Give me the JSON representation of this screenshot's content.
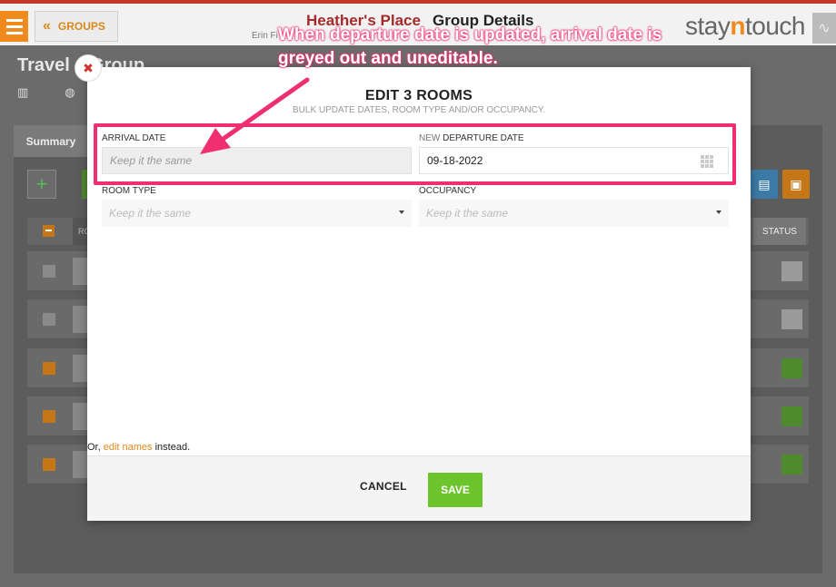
{
  "header": {
    "groups_label": "GROUPS",
    "hotel_name": "Heather's Place",
    "page_title": "Group Details",
    "user_name": "Erin Fi",
    "logo_left": "stay",
    "logo_mid": "n",
    "logo_right": "touch"
  },
  "group": {
    "title": "Travel   s Group"
  },
  "tabs": {
    "summary": "Summary"
  },
  "table": {
    "col_ro": "RO",
    "col_status": "STATUS",
    "rows": [
      {
        "checkbox": "unchecked",
        "status_color": "#9a9a9a"
      },
      {
        "checkbox": "unchecked",
        "status_color": "#9a9a9a"
      },
      {
        "checkbox": "checked",
        "status_color": "#4f8a2e"
      },
      {
        "checkbox": "checked",
        "status_color": "#4f8a2e"
      },
      {
        "checkbox": "checked",
        "status_color": "#4f8a2e"
      }
    ]
  },
  "modal": {
    "title": "EDIT 3 ROOMS",
    "subtitle": "BULK UPDATE DATES, ROOM TYPE AND/OR OCCUPANCY.",
    "arrival_label": "ARRIVAL DATE",
    "arrival_value": "Keep it the same",
    "departure_label_prefix": "NEW ",
    "departure_label": "DEPARTURE DATE",
    "departure_value": "09-18-2022",
    "room_type_label": "ROOM TYPE",
    "room_type_value": "Keep it the same",
    "occupancy_label": "OCCUPANCY",
    "occupancy_value": "Keep it the same",
    "footer_prefix": "Or, ",
    "footer_link": "edit names",
    "footer_suffix": " instead.",
    "cancel_label": "CANCEL",
    "save_label": "SAVE"
  },
  "annotation": {
    "text": "When departure date is updated, arrival date is greyed out and uneditable.",
    "color": "#ef2f6f"
  },
  "colors": {
    "accent": "#f08a1c",
    "save": "#6cc52d",
    "hotel": "#a52a2a"
  }
}
